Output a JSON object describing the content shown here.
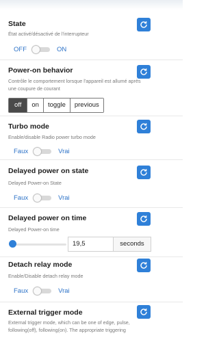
{
  "sections": {
    "state": {
      "title": "State",
      "description": "État activé/désactivé de l'interrupteur",
      "off_label": "OFF",
      "on_label": "ON"
    },
    "power_on_behavior": {
      "title": "Power-on behavior",
      "description": "Contrôle le comportement lorsque l'appareil est allumé après une coupure de courant",
      "options": [
        "off",
        "on",
        "toggle",
        "previous"
      ],
      "selected": "off"
    },
    "turbo_mode": {
      "title": "Turbo mode",
      "description": "Enable/disable Radio power turbo mode",
      "off_label": "Faux",
      "on_label": "Vrai"
    },
    "delayed_power_on_state": {
      "title": "Delayed power on state",
      "description": "Delayed Power-on State",
      "off_label": "Faux",
      "on_label": "Vrai"
    },
    "delayed_power_on_time": {
      "title": "Delayed power on time",
      "description": "Delayed Power-on time",
      "value": "19,5",
      "unit": "seconds",
      "slider_fraction": 0.0
    },
    "detach_relay_mode": {
      "title": "Detach relay mode",
      "description": "Enable/Disable detach relay mode",
      "off_label": "Faux",
      "on_label": "Vrai"
    },
    "external_trigger_mode": {
      "title": "External trigger mode",
      "description": "External trigger mode, which can be one of edge, pulse, following(off), following(on). The appropriate triggering"
    }
  },
  "colors": {
    "accent": "#2f80d8",
    "link_blue": "#2c72c7",
    "selected_segment": "#4a4a4a"
  },
  "icons": {
    "refresh": "refresh-icon"
  }
}
